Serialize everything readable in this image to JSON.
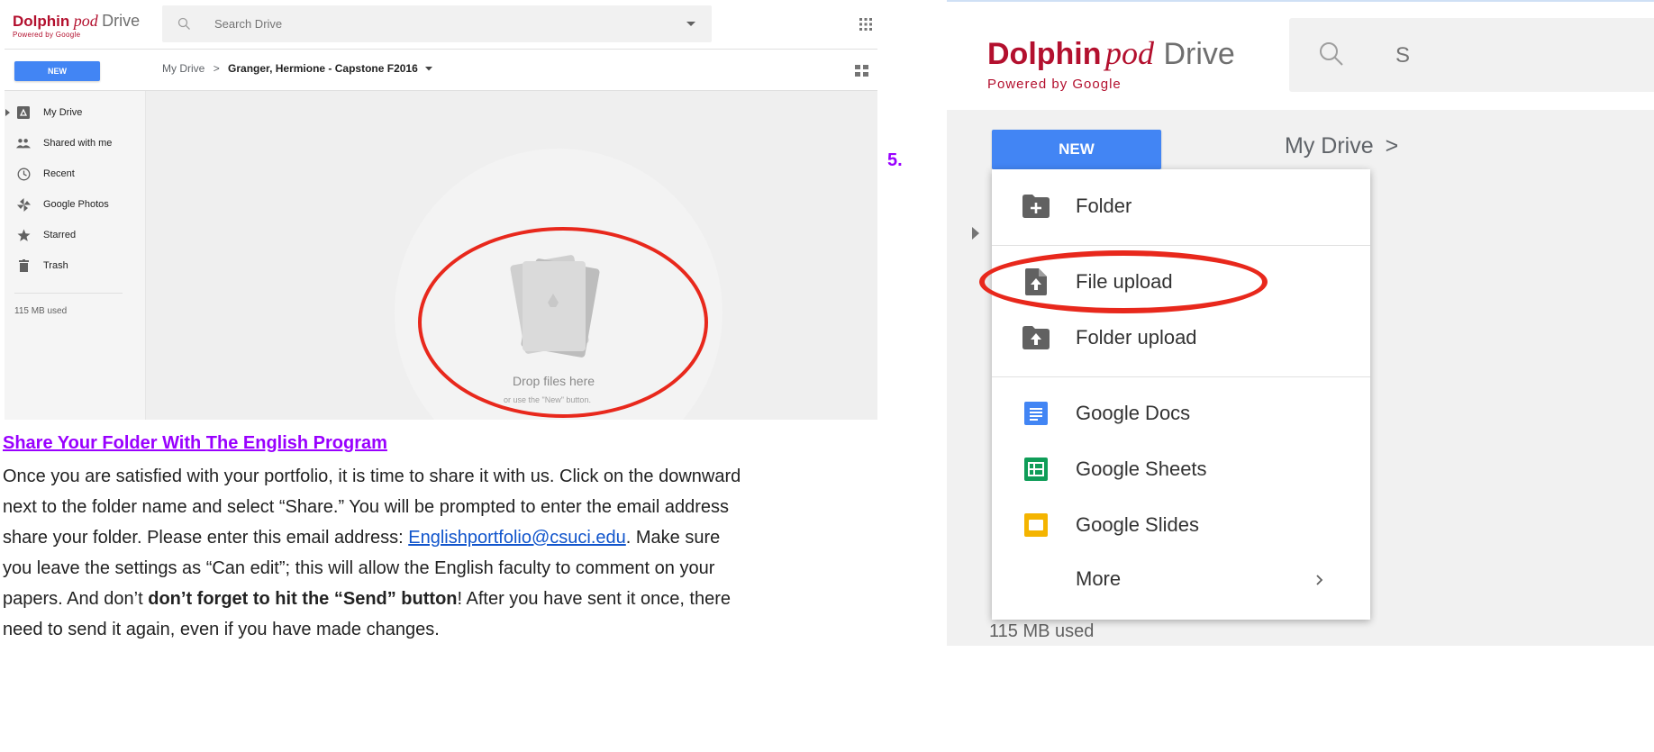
{
  "left_screenshot": {
    "logo": {
      "dolphin": "Dolphin",
      "pod": "pod",
      "drive": "Drive",
      "sub": "Powered by Google"
    },
    "search": {
      "placeholder": "Search Drive"
    },
    "new_button": "NEW",
    "breadcrumb": {
      "root": "My Drive",
      "separator": ">",
      "current": "Granger, Hermione - Capstone F2016"
    },
    "sidebar": {
      "items": [
        {
          "label": "My Drive",
          "icon": "drive-icon"
        },
        {
          "label": "Shared with me",
          "icon": "people-icon"
        },
        {
          "label": "Recent",
          "icon": "clock-icon"
        },
        {
          "label": "Google Photos",
          "icon": "pinwheel-icon"
        },
        {
          "label": "Starred",
          "icon": "star-icon"
        },
        {
          "label": "Trash",
          "icon": "trash-icon"
        }
      ],
      "storage": "115 MB used"
    },
    "drop_zone": {
      "title": "Drop files here",
      "subtitle": "or use the \"New\" button."
    }
  },
  "step_number": "5.",
  "instructions": {
    "title": "Share Your Folder With The English Program",
    "p1": "Once you are satisfied with your portfolio, it is time to share it with us. Click on the downward",
    "p2": "next to the folder name and select “Share.” You will be prompted to enter the email address",
    "p3_before": "share your folder. Please enter this email address: ",
    "p3_link": "Englishportfolio@csuci.edu",
    "p3_after": ". Make sure",
    "p4": "you leave the settings as “Can edit”; this will allow the English faculty to comment on your",
    "p5_before": "papers. And don’t ",
    "p5_bold": "don’t forget to hit the “Send” button",
    "p5_after": "! After you have sent it once, there",
    "p6": "need to send it again, even if you have made changes."
  },
  "right_screenshot": {
    "logo": {
      "dolphin": "Dolphin",
      "pod": "pod",
      "drive": "Drive",
      "sub": "Powered by Google"
    },
    "search_letter": "S",
    "new_button": "NEW",
    "breadcrumb_root": "My Drive",
    "breadcrumb_sep": ">",
    "menu": {
      "items": [
        {
          "label": "Folder",
          "icon": "folder-plus-icon"
        },
        {
          "label": "File upload",
          "icon": "file-upload-icon"
        },
        {
          "label": "Folder upload",
          "icon": "folder-upload-icon"
        },
        {
          "label": "Google Docs",
          "icon": "docs-icon"
        },
        {
          "label": "Google Sheets",
          "icon": "sheets-icon"
        },
        {
          "label": "Google Slides",
          "icon": "slides-icon"
        },
        {
          "label": "More",
          "icon": "chevron-right-icon"
        }
      ]
    },
    "storage": "115 MB used"
  },
  "colors": {
    "highlight": "#e8281c",
    "step": "#9900ff",
    "brand": "#b3102e",
    "new_button": "#4285f4"
  }
}
